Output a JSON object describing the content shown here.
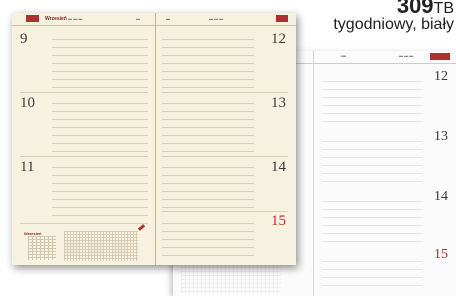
{
  "caption": {
    "code_number": "309",
    "code_suffix": "TB",
    "description": "tygodniowy, biały"
  },
  "front_planner": {
    "header_month": "Wrzesień",
    "left_days": [
      "9",
      "10",
      "11"
    ],
    "right_days": [
      "12",
      "13",
      "14",
      "15"
    ],
    "sunday_day": "15",
    "mini_calendar_title": "Wrzesień"
  },
  "back_planner": {
    "right_days": [
      "12",
      "13",
      "14",
      "15"
    ]
  },
  "colors": {
    "accent_red": "#b03030",
    "cream_paper": "#f7f1df",
    "white_paper": "#fbfbfb"
  }
}
